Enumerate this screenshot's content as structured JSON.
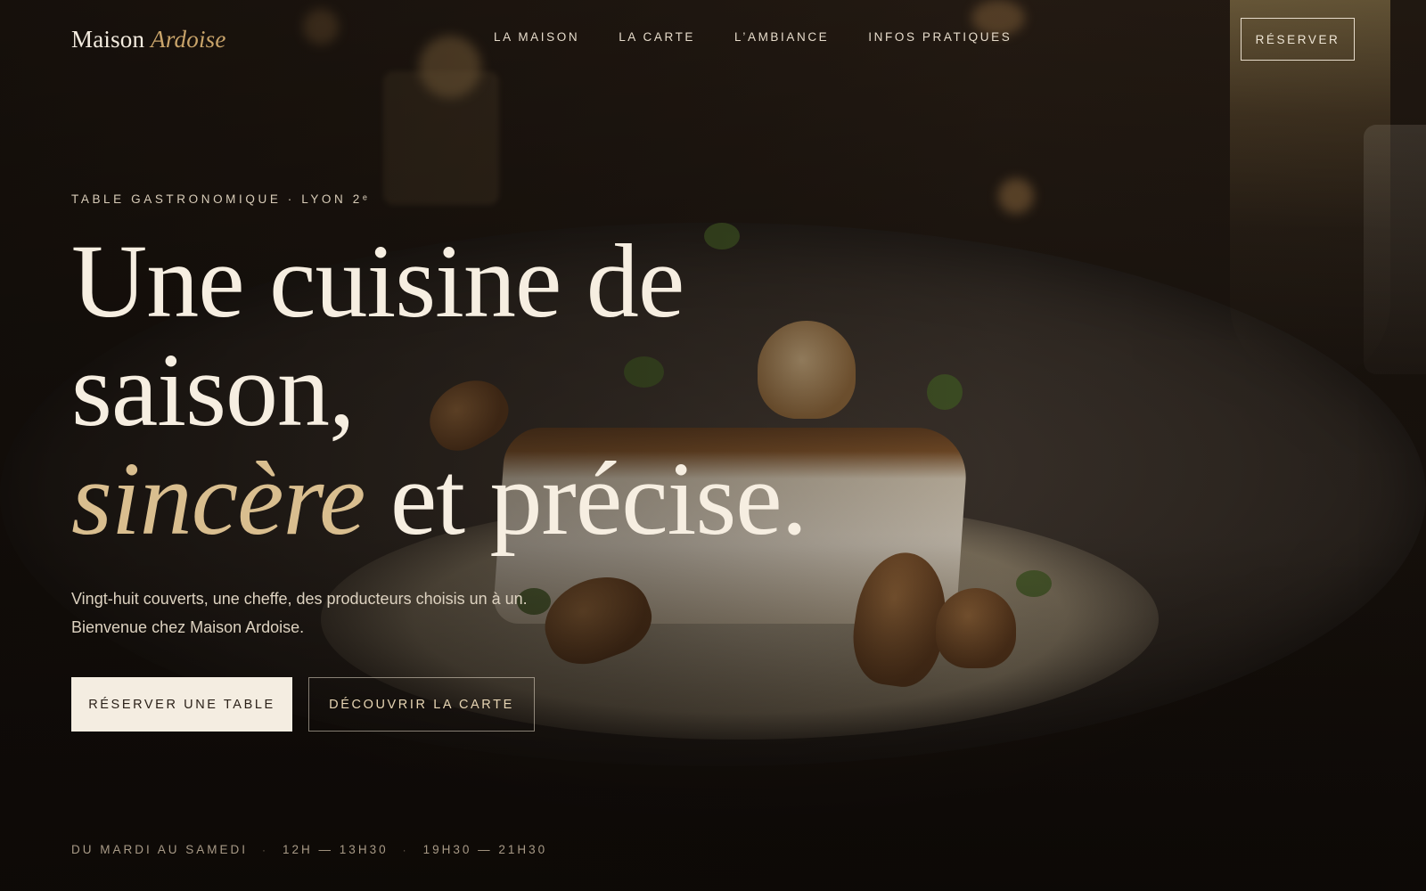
{
  "brand": {
    "name": "Maison",
    "name_accent": "Ardoise"
  },
  "nav": {
    "items": [
      {
        "label": "LA MAISON"
      },
      {
        "label": "LA CARTE"
      },
      {
        "label": "L’AMBIANCE"
      },
      {
        "label": "INFOS PRATIQUES"
      }
    ],
    "reserve_label": "RÉSERVER"
  },
  "hero": {
    "eyebrow": "TABLE GASTRONOMIQUE · LYON 2ᵉ",
    "headline": {
      "line1": "Une cuisine de",
      "line2": "saison,",
      "line3_italic": "sincère",
      "line3_rest": " et précise."
    },
    "lede": {
      "line1": "Vingt-huit couverts, une cheffe, des producteurs choisis un à un.",
      "line2": "Bienvenue chez Maison Ardoise."
    },
    "cta_primary": "RÉSERVER UNE TABLE",
    "cta_secondary": "DÉCOUVRIR LA CARTE"
  },
  "hours": {
    "days": "DU MARDI AU SAMEDI",
    "lunch": "12H — 13H30",
    "dinner": "19H30 — 21H30"
  },
  "colors": {
    "accent_gold": "#c9a46a",
    "headline_italic": "#d9be8f",
    "cta_primary_bg": "#f4ede1",
    "background": "#15100c"
  },
  "background_image": "plated-fish-dish-photo"
}
